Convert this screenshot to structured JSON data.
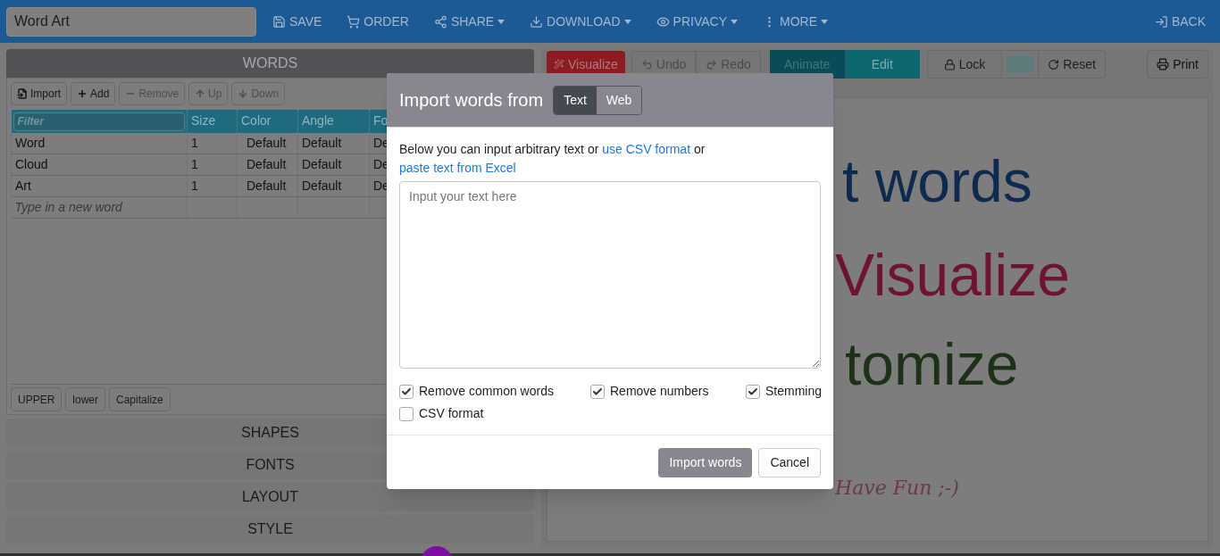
{
  "title_field": {
    "value": "Word Art"
  },
  "nav": [
    {
      "label": "SAVE",
      "dropdown": false
    },
    {
      "label": "ORDER",
      "dropdown": false
    },
    {
      "label": "SHARE",
      "dropdown": true
    },
    {
      "label": "DOWNLOAD",
      "dropdown": true
    },
    {
      "label": "PRIVACY",
      "dropdown": true
    },
    {
      "label": "MORE",
      "dropdown": true
    }
  ],
  "back": {
    "label": "BACK"
  },
  "words_panel": {
    "title": "WORDS",
    "toolbar": [
      {
        "label": "Import",
        "disabled": false
      },
      {
        "label": "Add",
        "disabled": false
      },
      {
        "label": "Remove",
        "disabled": true
      },
      {
        "label": "Up",
        "disabled": true
      },
      {
        "label": "Down",
        "disabled": true
      }
    ],
    "columns": [
      {
        "kind": "filter",
        "placeholder": "Filter"
      },
      {
        "kind": "label",
        "text": "Size"
      },
      {
        "kind": "label",
        "text": "Color"
      },
      {
        "kind": "label",
        "text": "Angle"
      },
      {
        "kind": "label",
        "text": "Fo"
      }
    ],
    "rows": [
      {
        "cells": [
          "Word",
          "1",
          "Default",
          "Default",
          "De"
        ]
      },
      {
        "cells": [
          "Cloud",
          "1",
          "Default",
          "Default",
          "De"
        ]
      },
      {
        "cells": [
          "Art",
          "1",
          "Default",
          "Default",
          "De"
        ]
      }
    ],
    "new_word": {
      "placeholder": "Type in a new word"
    },
    "case_buttons": [
      "UPPER",
      "lower",
      "Capitalize"
    ]
  },
  "sections": [
    "SHAPES",
    "FONTS",
    "LAYOUT",
    "STYLE"
  ],
  "canvas_toolbar": {
    "visualize": "Visualize",
    "undo": "Undo",
    "redo": "Redo",
    "modes": [
      {
        "label": "Animate",
        "selected": true
      },
      {
        "label": "Edit",
        "selected": false
      }
    ],
    "lock": "Lock",
    "reset": "Reset",
    "print": "Print"
  },
  "canvas": {
    "words": [
      {
        "text": "t words",
        "color": "#0e2a4e",
        "kind": "big"
      },
      {
        "text": "Visualize",
        "color": "#6e1433",
        "kind": "big"
      },
      {
        "text": "tomize",
        "color": "#1c3117",
        "kind": "big"
      },
      {
        "text": "Have Fun ;-)",
        "color": "#6b3a4a",
        "kind": "small"
      }
    ]
  },
  "dialog": {
    "title": "Import words from",
    "sources": [
      {
        "label": "Text",
        "selected": true
      },
      {
        "label": "Web",
        "selected": false
      }
    ],
    "intro": [
      "Below you can input arbitrary text or ",
      "use CSV format",
      " or ",
      "paste text from Excel"
    ],
    "textarea": {
      "placeholder": "Input your text here"
    },
    "options": [
      {
        "label": "Remove common words",
        "checked": true
      },
      {
        "label": "Remove numbers",
        "checked": true
      },
      {
        "label": "Stemming",
        "checked": true
      },
      {
        "label": "CSV format",
        "checked": false
      }
    ],
    "primary": "Import words",
    "cancel": "Cancel"
  }
}
